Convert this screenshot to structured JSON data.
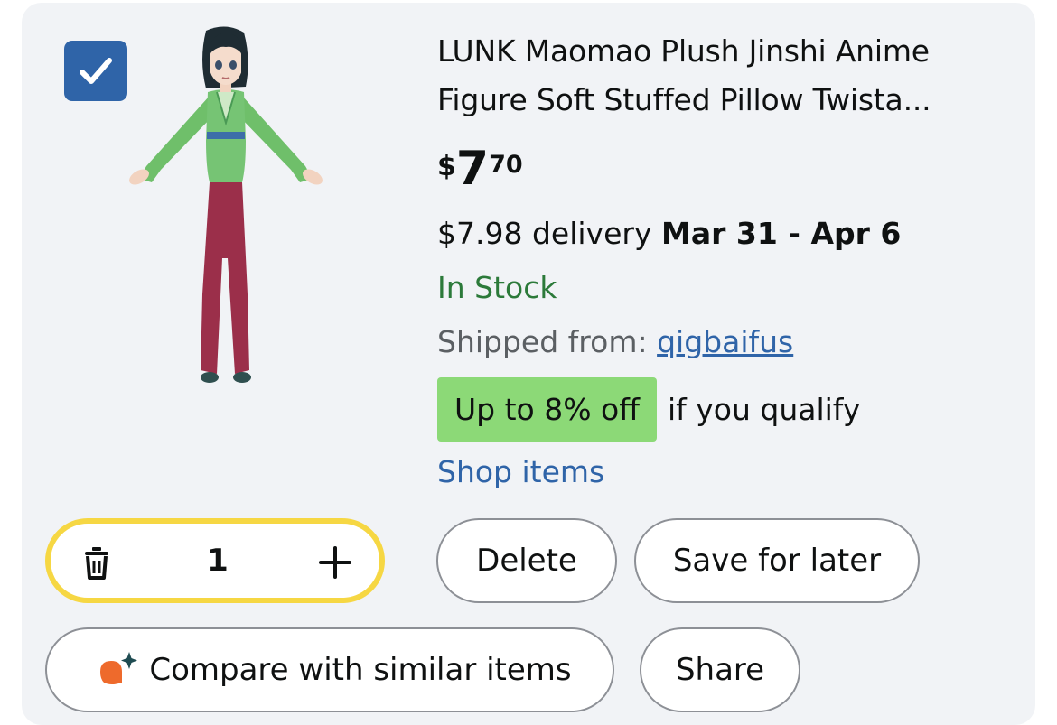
{
  "product": {
    "title": "LUNK Maomao Plush Jinshi Anime Figure Soft Stuffed Pillow Twista...",
    "price": {
      "currency": "$",
      "whole": "7",
      "fraction": "70"
    },
    "delivery": {
      "fee_text": "$7.98 delivery",
      "dates": "Mar 31 - Apr 6"
    },
    "stock": "In Stock",
    "shipped": {
      "label": "Shipped from:",
      "seller": "qigbaifus"
    },
    "offer": {
      "badge": "Up to 8% off",
      "text": "if you qualify"
    },
    "shop_items": "Shop items",
    "selected": true
  },
  "quantity": {
    "value": "1"
  },
  "actions": {
    "delete": "Delete",
    "save_for_later": "Save for later",
    "compare": "Compare with similar items",
    "share": "Share"
  },
  "colors": {
    "checkbox": "#2f64a8",
    "in_stock": "#2c7a3a",
    "link": "#2f64a8",
    "offer_badge": "#8cd977",
    "quantity_border": "#f6d743"
  },
  "icons": [
    "check-icon",
    "trash-icon",
    "plus-icon",
    "compare-sparkle-icon"
  ]
}
